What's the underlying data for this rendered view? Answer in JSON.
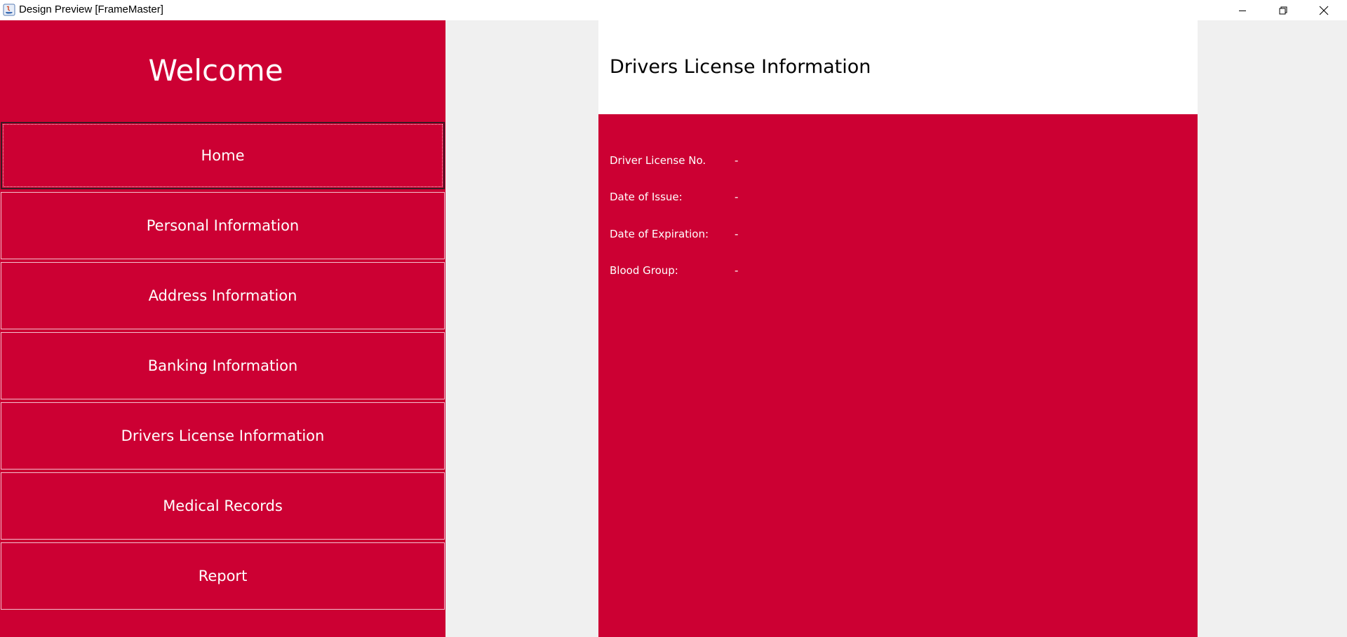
{
  "window": {
    "title": "Design Preview [FrameMaster]",
    "icon": "java-app-icon",
    "controls": [
      "minimize-icon",
      "restore-icon",
      "close-icon"
    ]
  },
  "sidebar": {
    "welcome": "Welcome",
    "items": [
      {
        "label": "Home"
      },
      {
        "label": "Personal Information"
      },
      {
        "label": "Address Information"
      },
      {
        "label": "Banking Information"
      },
      {
        "label": "Drivers License Information"
      },
      {
        "label": "Medical Records"
      },
      {
        "label": "Report"
      }
    ]
  },
  "main": {
    "title": "Drivers License Information",
    "fields": [
      {
        "label": "Driver License No.",
        "value": "-"
      },
      {
        "label": "Date of Issue:",
        "value": "-"
      },
      {
        "label": "Date of Expiration:",
        "value": "-"
      },
      {
        "label": "Blood Group:",
        "value": "-"
      }
    ]
  },
  "colors": {
    "accent": "#cc0033",
    "background": "#f0f0f0",
    "header": "#ffffff",
    "text_on_accent": "#ffffff"
  }
}
